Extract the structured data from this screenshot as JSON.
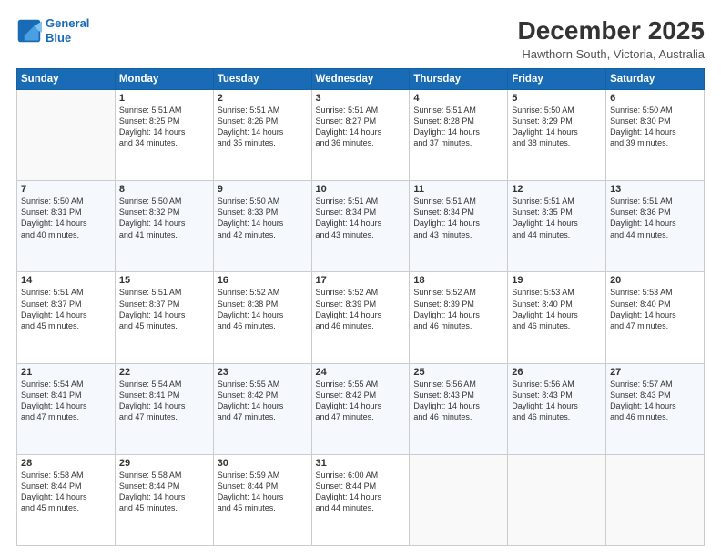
{
  "header": {
    "logo_line1": "General",
    "logo_line2": "Blue",
    "title": "December 2025",
    "subtitle": "Hawthorn South, Victoria, Australia"
  },
  "days_of_week": [
    "Sunday",
    "Monday",
    "Tuesday",
    "Wednesday",
    "Thursday",
    "Friday",
    "Saturday"
  ],
  "weeks": [
    [
      {
        "day": "",
        "text": ""
      },
      {
        "day": "1",
        "text": "Sunrise: 5:51 AM\nSunset: 8:25 PM\nDaylight: 14 hours\nand 34 minutes."
      },
      {
        "day": "2",
        "text": "Sunrise: 5:51 AM\nSunset: 8:26 PM\nDaylight: 14 hours\nand 35 minutes."
      },
      {
        "day": "3",
        "text": "Sunrise: 5:51 AM\nSunset: 8:27 PM\nDaylight: 14 hours\nand 36 minutes."
      },
      {
        "day": "4",
        "text": "Sunrise: 5:51 AM\nSunset: 8:28 PM\nDaylight: 14 hours\nand 37 minutes."
      },
      {
        "day": "5",
        "text": "Sunrise: 5:50 AM\nSunset: 8:29 PM\nDaylight: 14 hours\nand 38 minutes."
      },
      {
        "day": "6",
        "text": "Sunrise: 5:50 AM\nSunset: 8:30 PM\nDaylight: 14 hours\nand 39 minutes."
      }
    ],
    [
      {
        "day": "7",
        "text": "Sunrise: 5:50 AM\nSunset: 8:31 PM\nDaylight: 14 hours\nand 40 minutes."
      },
      {
        "day": "8",
        "text": "Sunrise: 5:50 AM\nSunset: 8:32 PM\nDaylight: 14 hours\nand 41 minutes."
      },
      {
        "day": "9",
        "text": "Sunrise: 5:50 AM\nSunset: 8:33 PM\nDaylight: 14 hours\nand 42 minutes."
      },
      {
        "day": "10",
        "text": "Sunrise: 5:51 AM\nSunset: 8:34 PM\nDaylight: 14 hours\nand 43 minutes."
      },
      {
        "day": "11",
        "text": "Sunrise: 5:51 AM\nSunset: 8:34 PM\nDaylight: 14 hours\nand 43 minutes."
      },
      {
        "day": "12",
        "text": "Sunrise: 5:51 AM\nSunset: 8:35 PM\nDaylight: 14 hours\nand 44 minutes."
      },
      {
        "day": "13",
        "text": "Sunrise: 5:51 AM\nSunset: 8:36 PM\nDaylight: 14 hours\nand 44 minutes."
      }
    ],
    [
      {
        "day": "14",
        "text": "Sunrise: 5:51 AM\nSunset: 8:37 PM\nDaylight: 14 hours\nand 45 minutes."
      },
      {
        "day": "15",
        "text": "Sunrise: 5:51 AM\nSunset: 8:37 PM\nDaylight: 14 hours\nand 45 minutes."
      },
      {
        "day": "16",
        "text": "Sunrise: 5:52 AM\nSunset: 8:38 PM\nDaylight: 14 hours\nand 46 minutes."
      },
      {
        "day": "17",
        "text": "Sunrise: 5:52 AM\nSunset: 8:39 PM\nDaylight: 14 hours\nand 46 minutes."
      },
      {
        "day": "18",
        "text": "Sunrise: 5:52 AM\nSunset: 8:39 PM\nDaylight: 14 hours\nand 46 minutes."
      },
      {
        "day": "19",
        "text": "Sunrise: 5:53 AM\nSunset: 8:40 PM\nDaylight: 14 hours\nand 46 minutes."
      },
      {
        "day": "20",
        "text": "Sunrise: 5:53 AM\nSunset: 8:40 PM\nDaylight: 14 hours\nand 47 minutes."
      }
    ],
    [
      {
        "day": "21",
        "text": "Sunrise: 5:54 AM\nSunset: 8:41 PM\nDaylight: 14 hours\nand 47 minutes."
      },
      {
        "day": "22",
        "text": "Sunrise: 5:54 AM\nSunset: 8:41 PM\nDaylight: 14 hours\nand 47 minutes."
      },
      {
        "day": "23",
        "text": "Sunrise: 5:55 AM\nSunset: 8:42 PM\nDaylight: 14 hours\nand 47 minutes."
      },
      {
        "day": "24",
        "text": "Sunrise: 5:55 AM\nSunset: 8:42 PM\nDaylight: 14 hours\nand 47 minutes."
      },
      {
        "day": "25",
        "text": "Sunrise: 5:56 AM\nSunset: 8:43 PM\nDaylight: 14 hours\nand 46 minutes."
      },
      {
        "day": "26",
        "text": "Sunrise: 5:56 AM\nSunset: 8:43 PM\nDaylight: 14 hours\nand 46 minutes."
      },
      {
        "day": "27",
        "text": "Sunrise: 5:57 AM\nSunset: 8:43 PM\nDaylight: 14 hours\nand 46 minutes."
      }
    ],
    [
      {
        "day": "28",
        "text": "Sunrise: 5:58 AM\nSunset: 8:44 PM\nDaylight: 14 hours\nand 45 minutes."
      },
      {
        "day": "29",
        "text": "Sunrise: 5:58 AM\nSunset: 8:44 PM\nDaylight: 14 hours\nand 45 minutes."
      },
      {
        "day": "30",
        "text": "Sunrise: 5:59 AM\nSunset: 8:44 PM\nDaylight: 14 hours\nand 45 minutes."
      },
      {
        "day": "31",
        "text": "Sunrise: 6:00 AM\nSunset: 8:44 PM\nDaylight: 14 hours\nand 44 minutes."
      },
      {
        "day": "",
        "text": ""
      },
      {
        "day": "",
        "text": ""
      },
      {
        "day": "",
        "text": ""
      }
    ]
  ]
}
